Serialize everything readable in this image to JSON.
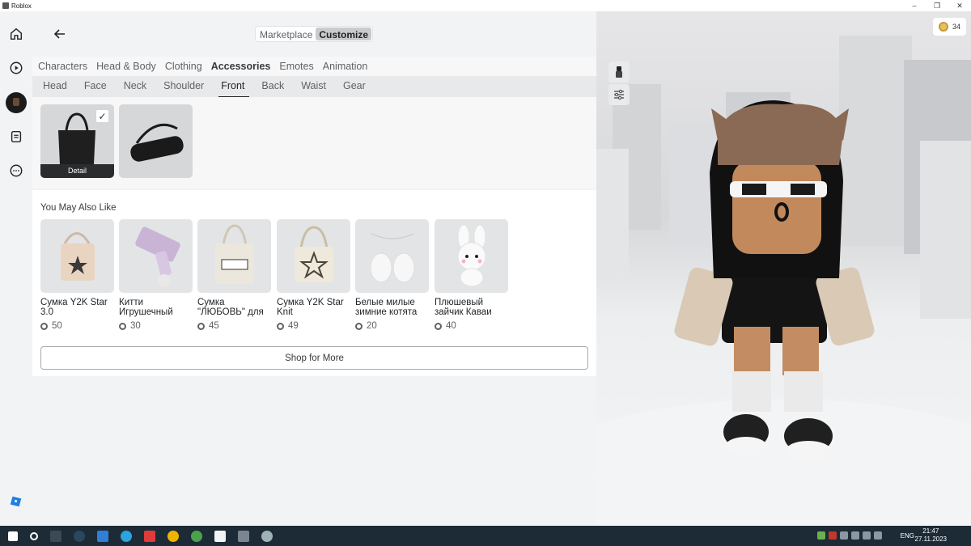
{
  "window": {
    "title": "Roblox",
    "controls": [
      "–",
      "❐",
      "✕"
    ]
  },
  "header": {
    "segments": [
      {
        "label": "Marketplace",
        "active": false
      },
      {
        "label": "Customize",
        "active": true
      }
    ]
  },
  "categories": [
    {
      "label": "Characters"
    },
    {
      "label": "Head & Body"
    },
    {
      "label": "Clothing"
    },
    {
      "label": "Accessories",
      "active": true
    },
    {
      "label": "Emotes"
    },
    {
      "label": "Animation"
    }
  ],
  "subcategories": [
    {
      "label": "Head"
    },
    {
      "label": "Face"
    },
    {
      "label": "Neck"
    },
    {
      "label": "Shoulder"
    },
    {
      "label": "Front",
      "active": true
    },
    {
      "label": "Back"
    },
    {
      "label": "Waist"
    },
    {
      "label": "Gear"
    }
  ],
  "equipped": {
    "detail_label": "Detail",
    "check_glyph": "✓"
  },
  "recommendations": {
    "title": "You May Also Like",
    "items": [
      {
        "name": "Сумка Y2K Star 3.0",
        "price": "50"
      },
      {
        "name": "Китти Игрушечный",
        "price": "30"
      },
      {
        "name": "Сумка \"ЛЮБОВЬ\" для",
        "price": "45"
      },
      {
        "name": "Сумка Y2K Star Knit",
        "price": "49"
      },
      {
        "name": "Белые милые зимние котята",
        "price": "20"
      },
      {
        "name": "Плюшевый зайчик Каваи",
        "price": "40"
      }
    ],
    "shop_button": "Shop for More"
  },
  "viewport": {
    "robux_balance": "34"
  },
  "taskbar": {
    "lang": "ENG",
    "time": "21:47",
    "date": "27.11.2023"
  },
  "colors": {
    "accent": "#232527",
    "robux_gold": "#e3c06b"
  }
}
